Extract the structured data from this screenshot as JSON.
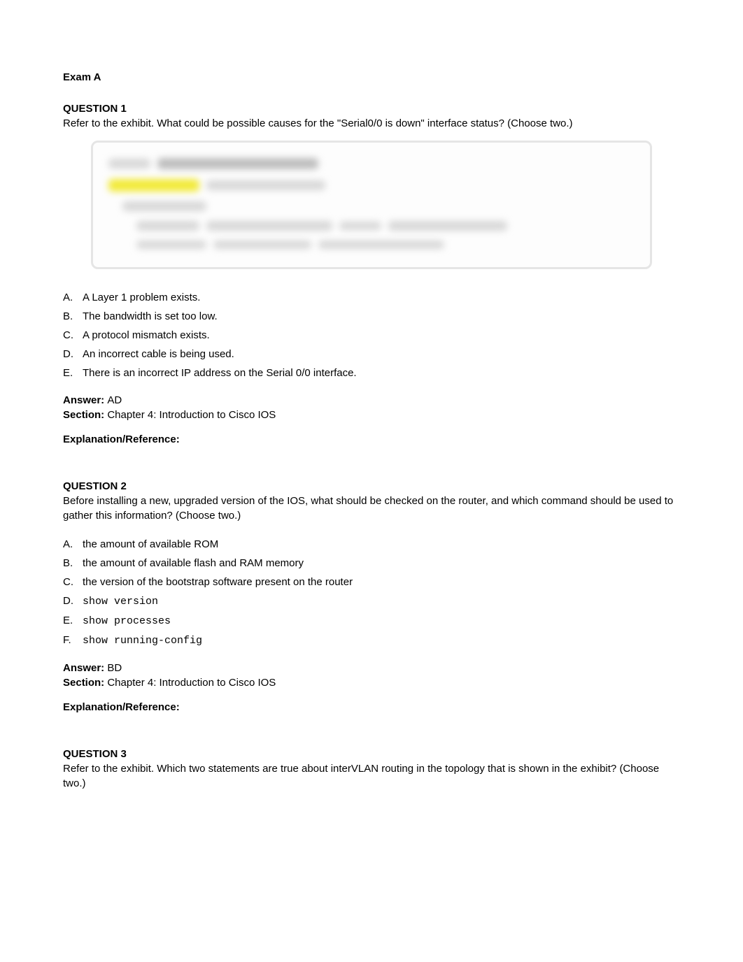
{
  "exam_title": "Exam A",
  "q1": {
    "title": "QUESTION 1",
    "text": "Refer to the exhibit. What could be possible causes for the \"Serial0/0 is down\" interface status? (Choose two.)",
    "options": {
      "A": "A Layer 1 problem exists.",
      "B": "The bandwidth is set too low.",
      "C": "A protocol mismatch exists.",
      "D": "An incorrect cable is being used.",
      "E": "There is an incorrect IP address on the Serial 0/0 interface."
    },
    "answer_label": "Answer: ",
    "answer_value": "AD",
    "section_label": "Section: ",
    "section_value": "Chapter 4: Introduction to Cisco IOS",
    "explain_label": "Explanation/Reference:"
  },
  "q2": {
    "title": "QUESTION 2",
    "text": "Before installing a new, upgraded version of the IOS, what should be checked on the router, and which command should be used to gather this information? (Choose two.)",
    "options": {
      "A": "the amount of available ROM",
      "B": "the amount of available flash and RAM memory",
      "C": "the version of the bootstrap software present on the router",
      "D": "show version",
      "E": "show processes",
      "F": "show running-config"
    },
    "answer_label": "Answer: ",
    "answer_value": "BD",
    "section_label": "Section: ",
    "section_value": "Chapter 4: Introduction to Cisco IOS",
    "explain_label": "Explanation/Reference:"
  },
  "q3": {
    "title": "QUESTION 3",
    "text": "Refer to the exhibit. Which two statements are true about interVLAN routing in the topology that is shown in the exhibit? (Choose two.)"
  },
  "letters": {
    "A": "A.",
    "B": "B.",
    "C": "C.",
    "D": "D.",
    "E": "E.",
    "F": "F."
  }
}
